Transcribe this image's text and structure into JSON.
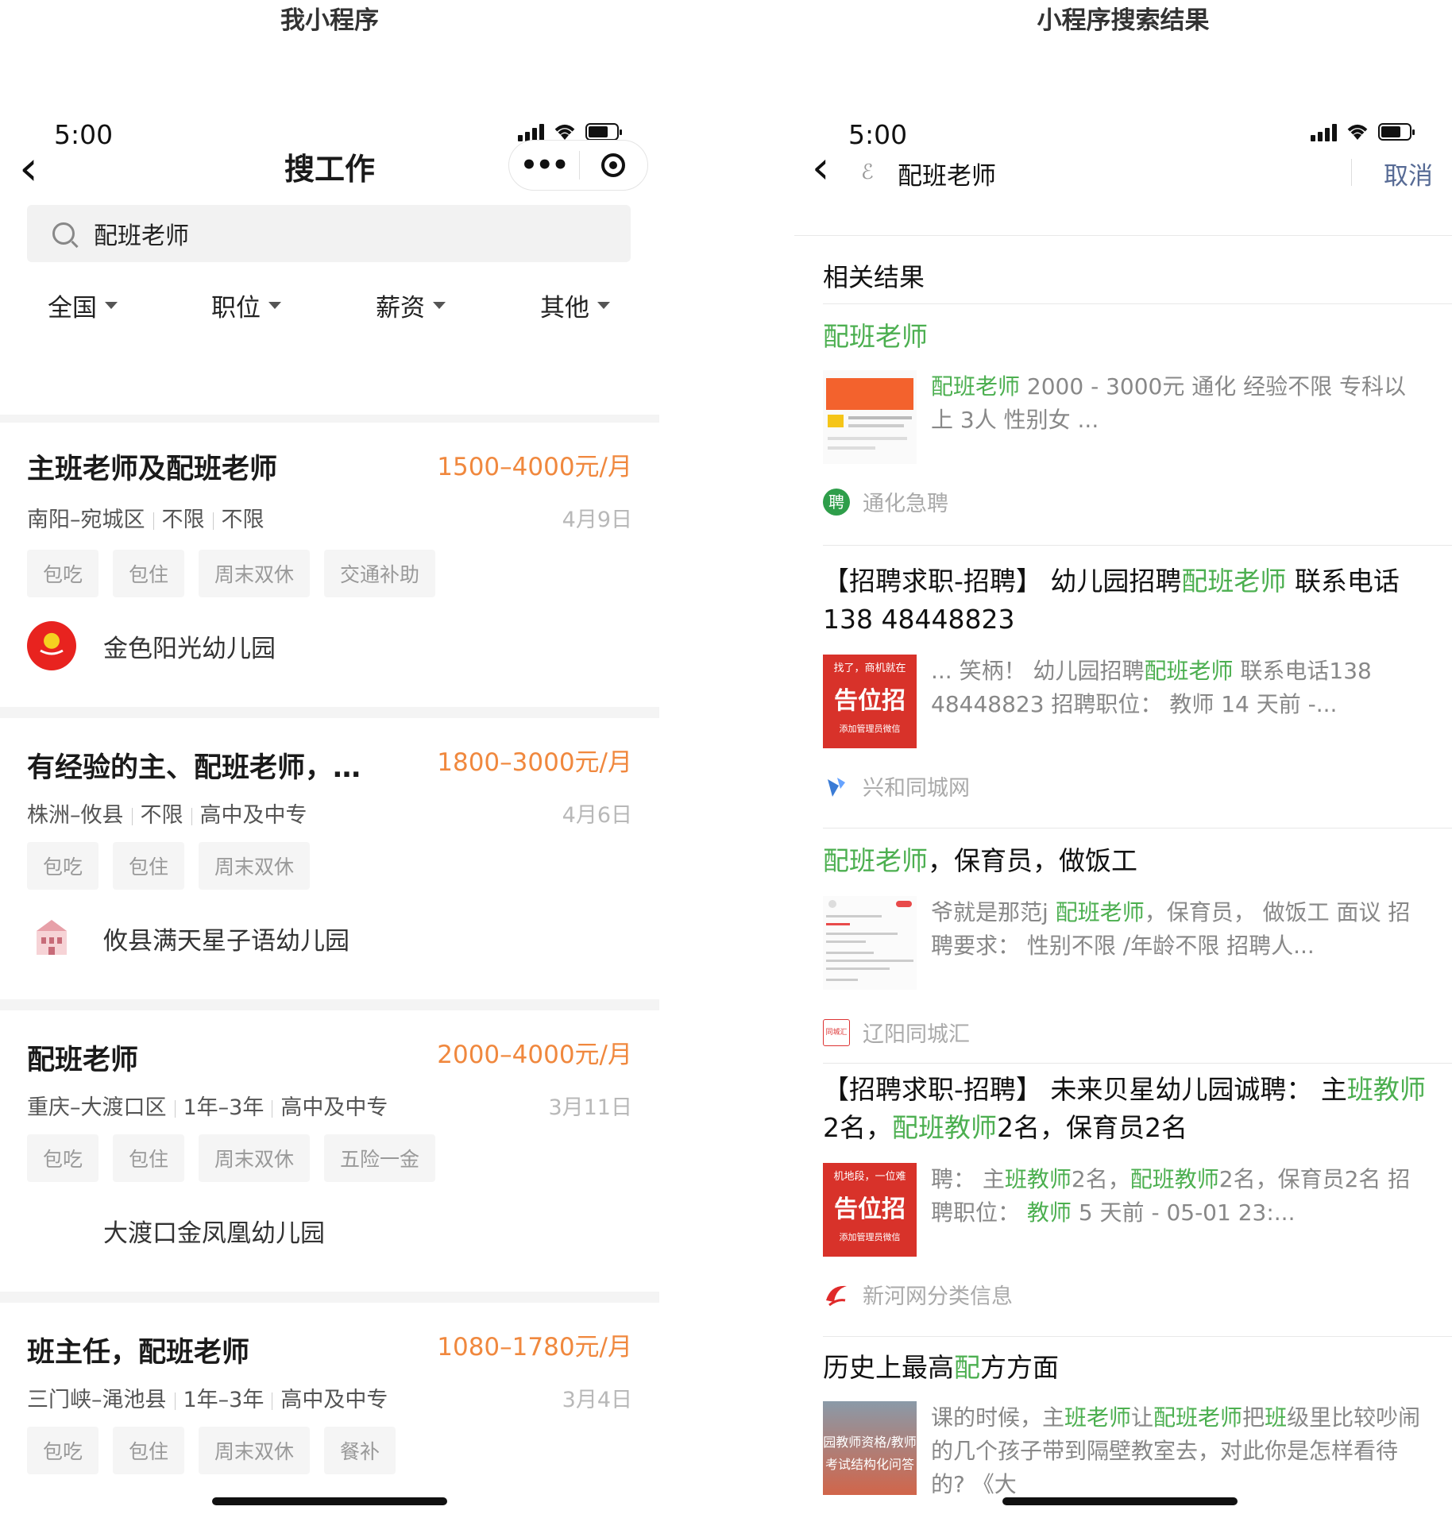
{
  "captions": {
    "left": "我小程序",
    "right": "小程序搜索结果"
  },
  "left": {
    "status": {
      "time": "5:00"
    },
    "header": {
      "back": "‹",
      "title": "搜工作",
      "more": "•••"
    },
    "search": {
      "value": "配班老师",
      "placeholder": ""
    },
    "filters": [
      "全国",
      "职位",
      "薪资",
      "其他"
    ],
    "jobs": [
      {
        "title": "主班老师及配班老师",
        "salary": "1500–4000元/月",
        "meta": [
          "南阳–宛城区",
          "不限",
          "不限"
        ],
        "date": "4月9日",
        "tags": [
          "包吃",
          "包住",
          "周末双休",
          "交通补助"
        ],
        "company": "金色阳光幼儿园",
        "logo_text": "金色阳光幼儿园"
      },
      {
        "title": "有经验的主、配班老师，…",
        "salary": "1800–3000元/月",
        "meta": [
          "株洲–攸县",
          "不限",
          "高中及中专"
        ],
        "date": "4月6日",
        "tags": [
          "包吃",
          "包住",
          "周末双休"
        ],
        "company": "攸县满天星子语幼儿园"
      },
      {
        "title": "配班老师",
        "salary": "2000–4000元/月",
        "meta": [
          "重庆–大渡口区",
          "1年–3年",
          "高中及中专"
        ],
        "date": "3月11日",
        "tags": [
          "包吃",
          "包住",
          "周末双休",
          "五险一金"
        ],
        "company": "大渡口金凤凰幼儿园"
      },
      {
        "title": "班主任，配班老师",
        "salary": "1080–1780元/月",
        "meta": [
          "三门峡–渑池县",
          "1年–3年",
          "高中及中专"
        ],
        "date": "3月4日",
        "tags": [
          "包吃",
          "包住",
          "周末双休",
          "餐补"
        ]
      }
    ]
  },
  "right": {
    "status": {
      "time": "5:00"
    },
    "header": {
      "back": "‹",
      "query": "配班老师",
      "cancel": "取消",
      "link_icon": "ℰ"
    },
    "section": "相关结果",
    "results": [
      {
        "title": [
          {
            "t": "配班老师",
            "h": true
          }
        ],
        "snippet": [
          {
            "t": "配班老师",
            "h": true
          },
          {
            "t": " 2000 - 3000元 通化 经验不限 专科以上 3人 性别女 ..."
          }
        ],
        "source": "通化急聘",
        "src_glyph": "聘"
      },
      {
        "title": [
          {
            "t": "【招聘求职-招聘】 幼儿园招聘"
          },
          {
            "t": "配班老师",
            "h": true
          },
          {
            "t": " 联系电话138 48448823"
          }
        ],
        "snippet": [
          {
            "t": "... 笑柄！ 幼儿园招聘"
          },
          {
            "t": "配班老师",
            "h": true
          },
          {
            "t": " 联系电话138 48448823 招聘职位： 教师 14 天前 -..."
          }
        ],
        "source": "兴和同城网",
        "thumb_lines": [
          "找了，商机就在",
          "告位招",
          "添加管理员微信"
        ]
      },
      {
        "title": [
          {
            "t": "配班老师",
            "h": true
          },
          {
            "t": "，保育员，做饭工"
          }
        ],
        "snippet": [
          {
            "t": "爷就是那范j "
          },
          {
            "t": "配班老师",
            "h": true
          },
          {
            "t": "，保育员， 做饭工 面议 招聘要求： 性别不限 /年龄不限 招聘人..."
          }
        ],
        "source": "辽阳同城汇",
        "src_glyph": "同城汇"
      },
      {
        "title": [
          {
            "t": "【招聘求职-招聘】 未来贝星幼儿园诚聘： 主"
          },
          {
            "t": "班教师",
            "h": true
          },
          {
            "t": "2名，"
          },
          {
            "t": "配班教师",
            "h": true
          },
          {
            "t": "2名，保育员2名"
          }
        ],
        "snippet": [
          {
            "t": "聘： 主"
          },
          {
            "t": "班教师",
            "h": true
          },
          {
            "t": "2名，"
          },
          {
            "t": "配班教师",
            "h": true
          },
          {
            "t": "2名，保育员2名 招聘职位： "
          },
          {
            "t": "教师",
            "h": true
          },
          {
            "t": " 5 天前 - 05-01 23:..."
          }
        ],
        "source": "新河网分类信息",
        "thumb_lines": [
          "机地段，一位难",
          "告位招",
          "添加管理员微信"
        ]
      },
      {
        "title": [
          {
            "t": "历史上最高"
          },
          {
            "t": "配",
            "h": true
          },
          {
            "t": "方方面"
          }
        ],
        "snippet": [
          {
            "t": "课的时候，主"
          },
          {
            "t": "班老师",
            "h": true
          },
          {
            "t": "让"
          },
          {
            "t": "配班老师",
            "h": true
          },
          {
            "t": "把"
          },
          {
            "t": "班",
            "h": true
          },
          {
            "t": "级里比较吵闹的几个孩子带到隔壁教室去，对此你是怎样看待的? 《大"
          }
        ],
        "thumb_lines": [
          "园教师资格/教师",
          "考试结构化问答"
        ]
      }
    ]
  },
  "colors": {
    "accent": "#4caf50",
    "salary": "#f0883e",
    "link": "#576b95"
  }
}
